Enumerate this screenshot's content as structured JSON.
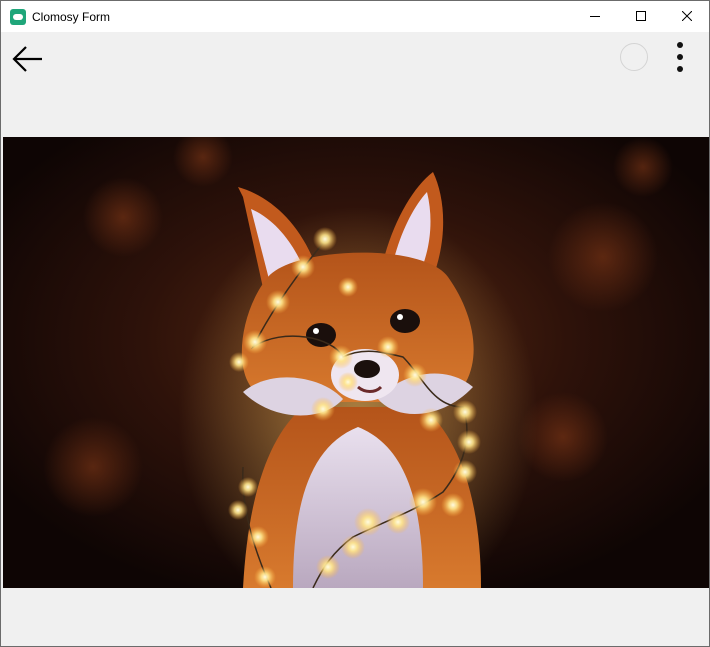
{
  "window": {
    "title": "Clomosy Form",
    "app_icon": "clomosy-app-icon",
    "controls": [
      "minimize-icon",
      "maximize-icon",
      "close-icon"
    ]
  },
  "toolbar": {
    "back_icon": "arrow-left-icon",
    "status_icon": "circle-outline-icon",
    "menu_icon": "more-vertical-icon"
  },
  "image": {
    "subject": "fox-with-fairy-lights",
    "colors": {
      "background": "#140806",
      "fur": "#c8621f",
      "glow": "#ffd36b"
    }
  }
}
